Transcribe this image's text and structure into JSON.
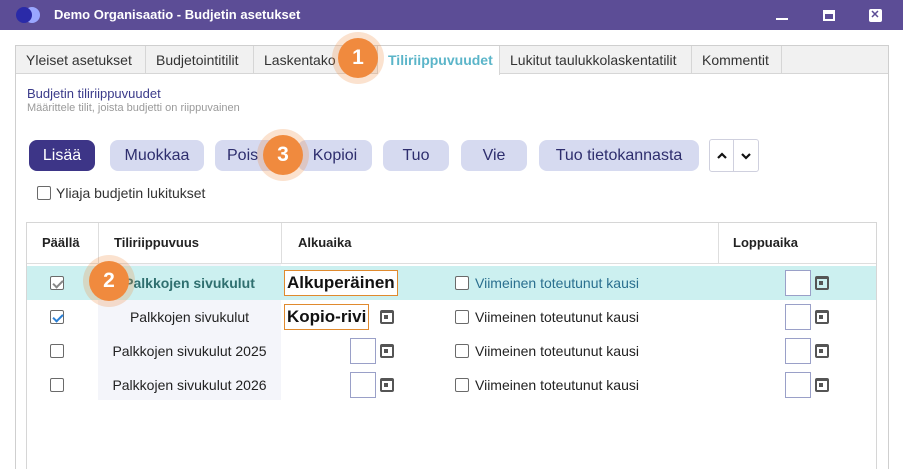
{
  "window": {
    "title": "Demo Organisaatio - Budjetin asetukset",
    "accent_color": "#5c4d96"
  },
  "tabs": [
    {
      "label": "Yleiset asetukset"
    },
    {
      "label": "Budjetointitilit"
    },
    {
      "label": "Laskentako"
    },
    {
      "label": "Tiliriippuvuudet",
      "active": true
    },
    {
      "label": "Lukitut taulukkolaskentatilit"
    },
    {
      "label": "Kommentit"
    }
  ],
  "section": {
    "title": "Budjetin tiliriippuvuudet",
    "subtitle": "Määrittele tilit, joista budjetti on riippuvainen"
  },
  "toolbar": {
    "add": "Lisää",
    "edit": "Muokkaa",
    "delete": "Pois",
    "copy": "Kopioi",
    "import": "Tuo",
    "export": "Vie",
    "import_db": "Tuo tietokannasta"
  },
  "override_lock": {
    "label": "Yliaja budjetin lukitukset",
    "checked": false
  },
  "table": {
    "headers": {
      "enabled": "Päällä",
      "dependency": "Tiliriippuvuus",
      "start": "Alkuaika",
      "end": "Loppuaika"
    },
    "rows": [
      {
        "enabled": true,
        "name": "Palkkojen sivukulut",
        "start_text": "Alkuperäinen",
        "latest_label": "Viimeinen toteutunut kausi",
        "latest_checked": false,
        "selected": true
      },
      {
        "enabled": true,
        "name": "Palkkojen sivukulut",
        "start_text": "Kopio-rivi",
        "latest_label": "Viimeinen toteutunut kausi",
        "latest_checked": false,
        "selected": false
      },
      {
        "enabled": false,
        "name": "Palkkojen sivukulut 2025",
        "start_text": "",
        "latest_label": "Viimeinen toteutunut kausi",
        "latest_checked": false,
        "selected": false
      },
      {
        "enabled": false,
        "name": "Palkkojen sivukulut 2026",
        "start_text": "",
        "latest_label": "Viimeinen toteutunut kausi",
        "latest_checked": false,
        "selected": false
      }
    ]
  },
  "badges": [
    "1",
    "2",
    "3"
  ]
}
